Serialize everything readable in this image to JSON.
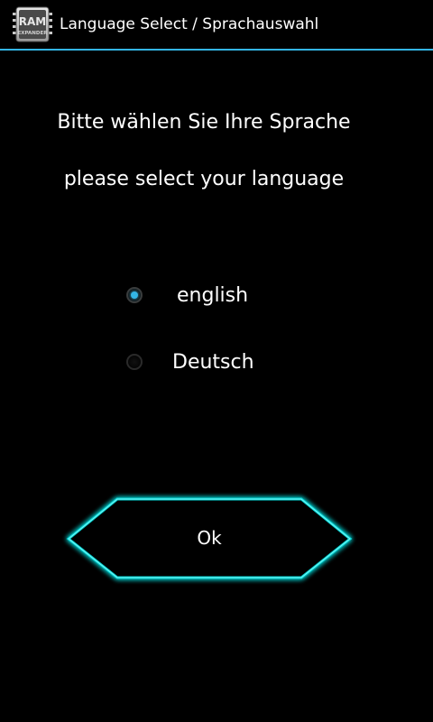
{
  "titlebar": {
    "title": "Language Select / Sprachauswahl",
    "icon": {
      "name": "ram-expander-app-icon",
      "line1": "RAM",
      "line2": "EXPANDER"
    },
    "accent_color": "#33b5e5"
  },
  "prompts": {
    "german": "Bitte wählen Sie Ihre Sprache",
    "english": "please select your language"
  },
  "language_options": [
    {
      "label": "english",
      "checked": true
    },
    {
      "label": "Deutsch",
      "checked": false
    }
  ],
  "ok_button": {
    "label": "Ok",
    "glow_color": "#00e5e5"
  }
}
